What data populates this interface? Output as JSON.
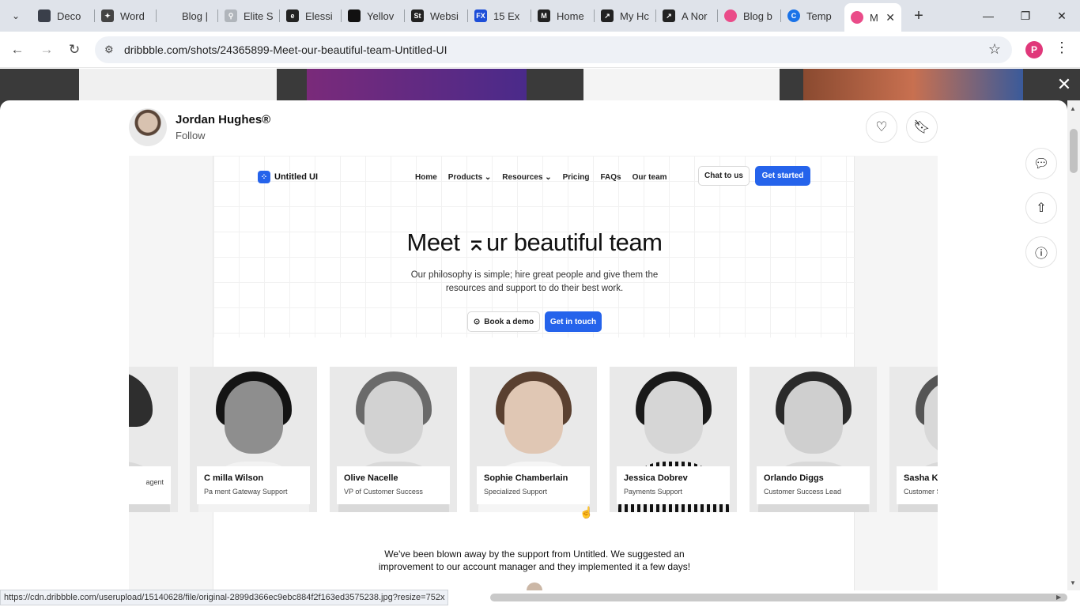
{
  "browser": {
    "tabs": [
      {
        "title": "Deco",
        "color": "#3a3f4a",
        "glyph": "▬"
      },
      {
        "title": "Word",
        "color": "#444",
        "glyph": "✦"
      },
      {
        "title": "Blog |",
        "color": "#ffffff",
        "glyph": ""
      },
      {
        "title": "Elite S",
        "color": "#9aa0a6",
        "glyph": "⚲"
      },
      {
        "title": "Elessi",
        "color": "#222",
        "glyph": "e"
      },
      {
        "title": "Yellov",
        "color": "#111",
        "glyph": "▮"
      },
      {
        "title": "Websi",
        "color": "#222",
        "glyph": "St"
      },
      {
        "title": "15 Ex",
        "color": "#1d4ed8",
        "glyph": "FX"
      },
      {
        "title": "Home",
        "color": "#222",
        "glyph": "M"
      },
      {
        "title": "My Hc",
        "color": "#222",
        "glyph": "↗"
      },
      {
        "title": "A Nor",
        "color": "#222",
        "glyph": "↗"
      },
      {
        "title": "Blog b",
        "color": "#ea4c89",
        "glyph": "◎"
      },
      {
        "title": "Temp",
        "color": "#1a73e8",
        "glyph": "C"
      },
      {
        "title": "M",
        "color": "#ea4c89",
        "glyph": "◎"
      }
    ],
    "url": "dribbble.com/shots/24365899-Meet-our-beautiful-team-Untitled-UI",
    "profile_initial": "P",
    "status_url": "https://cdn.dribbble.com/userupload/15140628/file/original-2899d366ec9ebc884f2f163ed3575238.jpg?resize=752x"
  },
  "shot": {
    "author": "Jordan Hughes®",
    "follow_label": "Follow"
  },
  "design": {
    "brand": "Untitled UI",
    "nav": [
      "Home",
      "Products ⌄",
      "Resources ⌄",
      "Pricing",
      "FAQs",
      "Our team"
    ],
    "chat_label": "Chat to us",
    "get_started_label": "Get started",
    "title": "Meet ⌅ur beautiful team",
    "subtitle": "Our philosophy is simple; hire great people and give them the resources and support to do their best work.",
    "demo_label": "Book a demo",
    "contact_label": "Get in touch",
    "team": [
      {
        "name": "",
        "role": "agent"
      },
      {
        "name": "C milla Wilson",
        "role": "Pa ment Gateway Support"
      },
      {
        "name": "Olive Nacelle",
        "role": "VP of Customer Success"
      },
      {
        "name": "Sophie Chamberlain",
        "role": "Specialized Support"
      },
      {
        "name": "Jessica Dobrev",
        "role": "Payments Support"
      },
      {
        "name": "Orlando Diggs",
        "role": "Customer Success Lead"
      },
      {
        "name": "Sasha Ki",
        "role": "Customer S"
      }
    ],
    "quote": "We've been blown away by the support from Untitled. We suggested an improvement to our account manager and they implemented it a few days!"
  }
}
